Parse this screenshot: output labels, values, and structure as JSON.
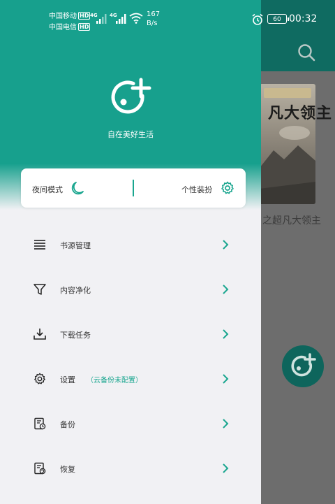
{
  "status_bar": {
    "carrier1": "中国移动",
    "carrier2": "中国电信",
    "hd1": "HD",
    "hd2": "HD",
    "net1": "4G",
    "net2": "4G",
    "speed_value": "167",
    "speed_unit": "B/s",
    "battery": "60",
    "time": "00:32",
    "icons": [
      "signal-icon",
      "wifi-icon",
      "alarm-icon",
      "battery-icon"
    ]
  },
  "background": {
    "book_title": "之超凡大领主",
    "cover_text": "凡大领主",
    "icons": [
      "search-icon",
      "add-source-fab-icon"
    ]
  },
  "drawer": {
    "slogan": "自在美好生活",
    "quick": {
      "night_mode": "夜间模式",
      "theme": "个性装扮"
    },
    "menu": [
      {
        "label": "书源管理",
        "icon": "list-icon"
      },
      {
        "label": "内容净化",
        "icon": "filter-icon"
      },
      {
        "label": "下载任务",
        "icon": "download-icon"
      },
      {
        "label": "设置",
        "note": "（云备份未配置）",
        "icon": "gear-icon"
      },
      {
        "label": "备份",
        "icon": "backup-icon"
      },
      {
        "label": "恢复",
        "icon": "restore-icon"
      }
    ]
  },
  "colors": {
    "accent": "#17a08d",
    "header_dim": "#0f6b61",
    "drawer_bg": "#f1f1f4"
  }
}
